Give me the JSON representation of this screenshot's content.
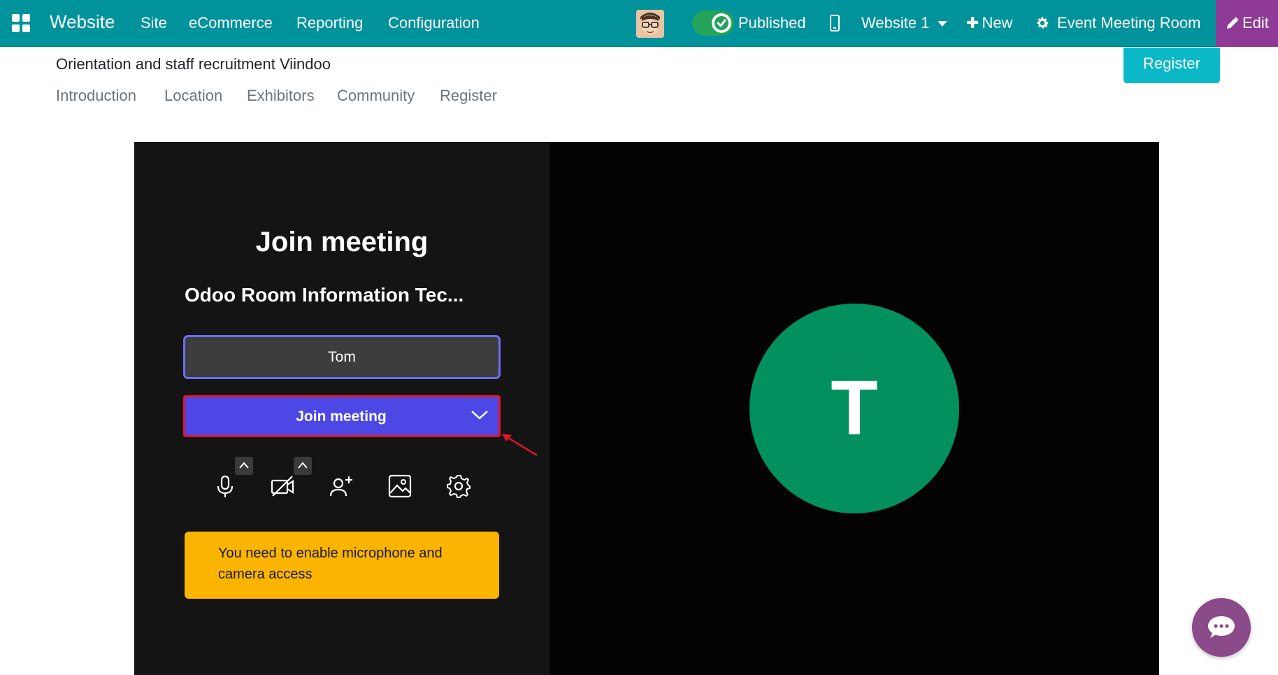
{
  "navbar": {
    "brand": "Website",
    "menu": [
      "Site",
      "eCommerce",
      "Reporting",
      "Configuration"
    ],
    "published_label": "Published",
    "website_select": "Website 1",
    "new_label": "New",
    "room_label": "Event Meeting Room",
    "edit_label": "Edit",
    "toggle_on": true
  },
  "event": {
    "title": "Orientation and staff recruitment Viindoo",
    "register_button": "Register",
    "subnav": [
      "Introduction",
      "Location",
      "Exhibitors",
      "Community",
      "Register"
    ]
  },
  "meeting": {
    "heading": "Join meeting",
    "room_name": "Odoo Room Information Tec...",
    "name_value": "Tom",
    "join_button": "Join meeting",
    "warning": "You need to enable microphone and camera access",
    "avatar_initial": "T",
    "controls": [
      "microphone-icon",
      "camera-off-icon",
      "invite-person-icon",
      "background-image-icon",
      "settings-gear-icon"
    ]
  },
  "colors": {
    "navbar": "#01939c",
    "edit": "#8f3a96",
    "join_button": "#4d47e6",
    "highlight": "#e0142c",
    "warning": "#fbb500",
    "avatar": "#02905f",
    "chat": "#8b4a8a"
  }
}
